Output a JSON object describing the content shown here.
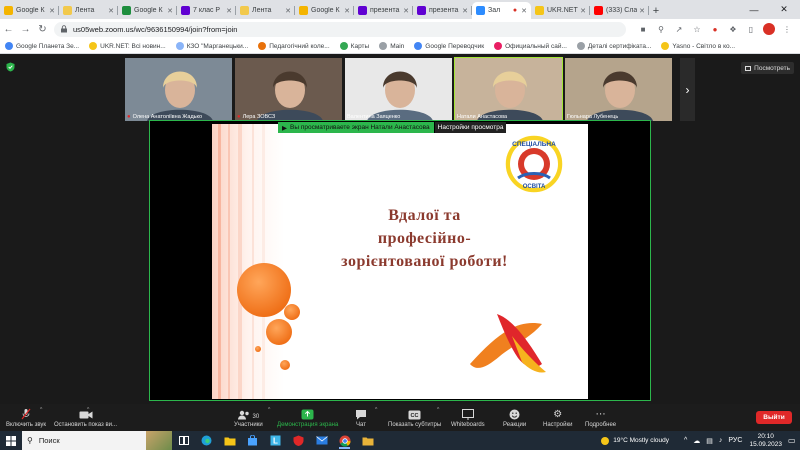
{
  "browser": {
    "tabs": [
      {
        "label": "Google К",
        "icon": "google-drive-icon",
        "color": "#f4b400",
        "active": false
      },
      {
        "label": "Лента",
        "icon": "lenta-icon",
        "color": "#f2c94c",
        "active": false
      },
      {
        "label": "Google К",
        "icon": "google-classroom-icon",
        "color": "#1e8e3e",
        "active": false
      },
      {
        "label": "7 клас Р",
        "icon": "yahoo-icon",
        "color": "#6001d2",
        "active": false
      },
      {
        "label": "Лента",
        "icon": "lenta-icon",
        "color": "#f2c94c",
        "active": false
      },
      {
        "label": "Google К",
        "icon": "google-drive-icon",
        "color": "#f4b400",
        "active": false
      },
      {
        "label": "презента",
        "icon": "yahoo-icon",
        "color": "#6001d2",
        "active": false
      },
      {
        "label": "презента",
        "icon": "yahoo-icon",
        "color": "#6001d2",
        "active": false
      },
      {
        "label": "Зал",
        "icon": "zoom-icon",
        "color": "#2d8cff",
        "active": true
      },
      {
        "label": "UKR.NET",
        "icon": "ukrnet-icon",
        "color": "#f5c518",
        "active": false
      },
      {
        "label": "(333) Сла",
        "icon": "youtube-icon",
        "color": "#ff0000",
        "active": false
      }
    ],
    "url": "us05web.zoom.us/wc/9636150994/join?from=join",
    "bookmarks": [
      {
        "label": "Google Планета Зе...",
        "color": "#4285f4"
      },
      {
        "label": "UKR.NET: Всі новин...",
        "color": "#f5c518"
      },
      {
        "label": "КЗО \"Марганецьки...",
        "color": "#8ab4f8"
      },
      {
        "label": "Педагогічний колe...",
        "color": "#e8710a"
      },
      {
        "label": "Карты",
        "color": "#34a853"
      },
      {
        "label": "Main",
        "color": "#9aa0a6"
      },
      {
        "label": "Google Переводчик",
        "color": "#4285f4"
      },
      {
        "label": "Официальный сай...",
        "color": "#e91e63"
      },
      {
        "label": "Деталі сертифіката...",
        "color": "#9aa0a6"
      },
      {
        "label": "Yasno - Світло в ко...",
        "color": "#f5c518"
      }
    ]
  },
  "zoom": {
    "view_button": "Посмотреть",
    "participants": [
      {
        "name": "Олена Анатоліївна Жадько",
        "muted": true,
        "bg": "#7d8a96"
      },
      {
        "name": "Лера ЗОВСЗ",
        "muted": true,
        "bg": "#6b5a4e"
      },
      {
        "name": "Валентина Заяценко",
        "muted": false,
        "bg": "#e8e8e8"
      },
      {
        "name": "Натали Анастасова",
        "muted": false,
        "bg": "#c7b39b"
      },
      {
        "name": "Гюльнара Лубенець",
        "muted": false,
        "bg": "#b5a48c"
      }
    ],
    "share_notice": "Вы просматриваете экран Натали Анастасова",
    "view_settings": "Настройки просмотра",
    "slide": {
      "title_lines": [
        "Вдалої та",
        "професійно-",
        "зорієнтованої роботи!"
      ],
      "logo_text_top": "СПЕЦІАЛЬНА",
      "logo_text_bottom": "ОСВІТА"
    },
    "toolbar": {
      "unmute": "Включить звук",
      "stop_video": "Остановить показ ви...",
      "participants": "Участники",
      "participants_count": "30",
      "share_screen": "Демонстрация экрана",
      "chat": "Чат",
      "subtitles": "Показать субтитры",
      "whiteboards": "Whiteboards",
      "reactions": "Реакции",
      "settings": "Настройки",
      "more": "Подробнее",
      "leave": "Выйти"
    }
  },
  "taskbar": {
    "search_placeholder": "Поиск",
    "weather": "19°C  Mostly cloudy",
    "language": "РУС",
    "time": "20:10",
    "date": "15.09.2023"
  },
  "colors": {
    "zoom_green": "#2cb64c",
    "leave_red": "#e02828",
    "slide_title": "#8b3a2e",
    "slide_circle": "#f47b20"
  }
}
